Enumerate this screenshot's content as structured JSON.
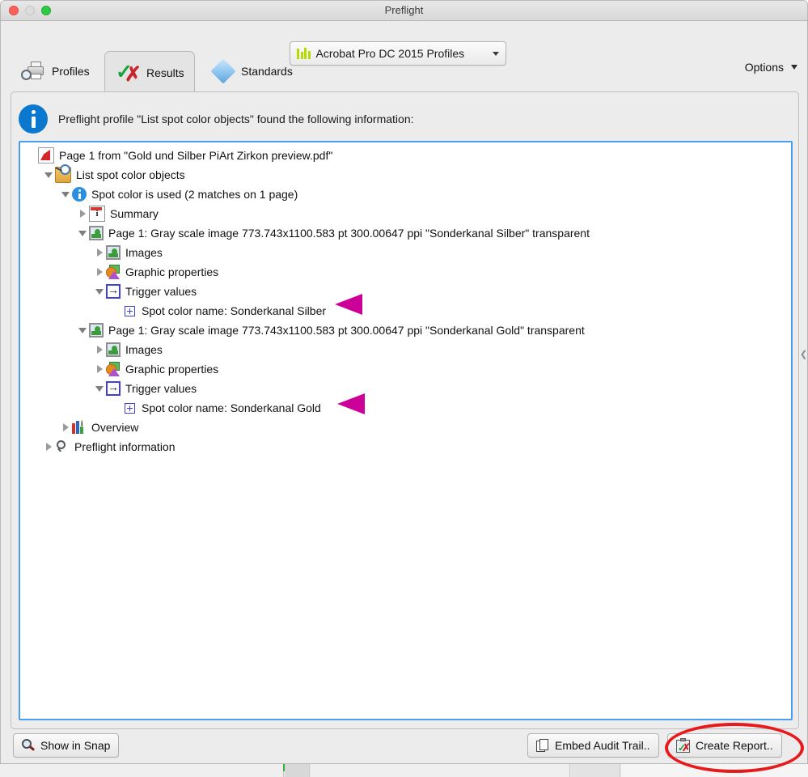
{
  "window": {
    "title": "Preflight",
    "traffic_lights": [
      "close",
      "minimize",
      "zoom"
    ]
  },
  "toolbar": {
    "profile_selector_label": "Acrobat Pro DC 2015 Profiles",
    "profile_selector_icon": "bar-chart-icon",
    "caret_icon": "chevron-down-icon"
  },
  "tabs": [
    {
      "id": "profiles",
      "label": "Profiles",
      "icon": "printer-magnifier-icon",
      "active": false
    },
    {
      "id": "results",
      "label": "Results",
      "icon": "check-cross-icon",
      "active": true
    },
    {
      "id": "standards",
      "label": "Standards",
      "icon": "diamond-icon",
      "active": false
    }
  ],
  "options": {
    "label": "Options",
    "icon": "chevron-down-icon"
  },
  "info": {
    "icon": "info-circle-icon",
    "message": "Preflight profile \"List spot color objects\" found the following information:"
  },
  "tree": [
    {
      "indent": 0,
      "twisty": "none",
      "icon": "pdf-document-icon",
      "label": "Page 1 from \"Gold und Silber PiArt Zirkon preview.pdf\""
    },
    {
      "indent": 1,
      "twisty": "expanded",
      "icon": "profile-icon",
      "label": "List spot color objects"
    },
    {
      "indent": 2,
      "twisty": "expanded",
      "icon": "info-small-icon",
      "label": "Spot color is used (2 matches on 1 page)"
    },
    {
      "indent": 3,
      "twisty": "collapsed",
      "icon": "summary-icon",
      "label": "Summary"
    },
    {
      "indent": 3,
      "twisty": "expanded",
      "icon": "image-icon",
      "label": "Page 1: Gray scale image 773.743x1100.583 pt 300.00647 ppi \"Sonderkanal Silber\" transparent"
    },
    {
      "indent": 4,
      "twisty": "collapsed",
      "icon": "image-icon",
      "label": "Images"
    },
    {
      "indent": 4,
      "twisty": "collapsed",
      "icon": "graphic-props-icon",
      "label": "Graphic properties"
    },
    {
      "indent": 4,
      "twisty": "expanded",
      "icon": "trigger-icon",
      "label": "Trigger values"
    },
    {
      "indent": 5,
      "twisty": "none",
      "icon": "leaf-node-icon",
      "label": "Spot color name: Sonderkanal Silber"
    },
    {
      "indent": 3,
      "twisty": "expanded",
      "icon": "image-icon",
      "label": "Page 1: Gray scale image 773.743x1100.583 pt 300.00647 ppi \"Sonderkanal Gold\" transparent"
    },
    {
      "indent": 4,
      "twisty": "collapsed",
      "icon": "image-icon",
      "label": "Images"
    },
    {
      "indent": 4,
      "twisty": "collapsed",
      "icon": "graphic-props-icon",
      "label": "Graphic properties"
    },
    {
      "indent": 4,
      "twisty": "expanded",
      "icon": "trigger-icon",
      "label": "Trigger values"
    },
    {
      "indent": 5,
      "twisty": "none",
      "icon": "leaf-node-icon",
      "label": "Spot color name: Sonderkanal Gold"
    },
    {
      "indent": 2,
      "twisty": "collapsed",
      "icon": "overview-chart-icon",
      "label": "Overview"
    },
    {
      "indent": 1,
      "twisty": "collapsed",
      "icon": "magnifier-icon",
      "label": "Preflight information"
    }
  ],
  "annotations": {
    "arrow_color": "#CC0099",
    "ellipse_color": "#E8191B",
    "arrows": [
      {
        "target": "Spot color name: Sonderkanal Silber"
      },
      {
        "target": "Spot color name: Sonderkanal Gold"
      }
    ],
    "ellipse_target": "Create Report.."
  },
  "bottom_bar": {
    "show_in_snap": {
      "label": "Show in Snap",
      "icon": "magnifier-icon"
    },
    "embed_audit_trail": {
      "label": "Embed Audit Trail..",
      "icon": "pages-icon"
    },
    "create_report": {
      "label": "Create Report..",
      "icon": "report-clipboard-icon"
    }
  },
  "colors": {
    "window_bg": "#ECECEC",
    "tree_bg": "#FFFFFF",
    "tree_focus_border": "#4A9EF0",
    "info_blue": "#0B78D0",
    "accent_magenta": "#CC0099",
    "accent_red": "#E8191B",
    "profile_icon_green": "#B7D905"
  }
}
